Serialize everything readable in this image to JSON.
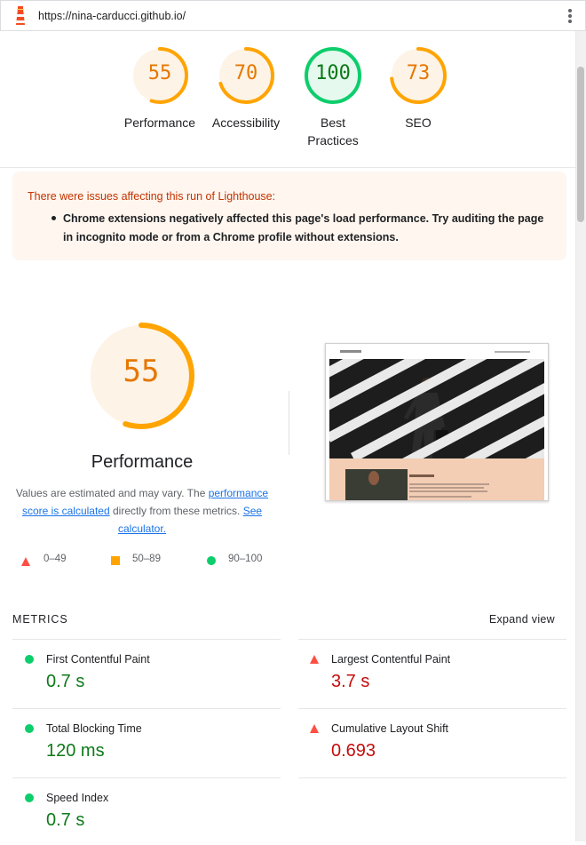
{
  "app": {
    "url": "https://nina-carducci.github.io/"
  },
  "colors": {
    "average": "#ffa400",
    "average_text": "#e67700",
    "pass": "#0cce6b",
    "pass_text": "#0c7a18",
    "fail": "#ff4e42",
    "fail_text": "#c50c0c",
    "link": "#1a73e8",
    "warning_bg": "#fef6ef",
    "warning_text": "#c33300"
  },
  "gauges": [
    {
      "score": "55",
      "label_line1": "Performance",
      "label_line2": "",
      "fraction": 0.55,
      "rating": "average"
    },
    {
      "score": "70",
      "label_line1": "Accessibility",
      "label_line2": "",
      "fraction": 0.7,
      "rating": "average"
    },
    {
      "score": "100",
      "label_line1": "Best",
      "label_line2": "Practices",
      "fraction": 1.0,
      "rating": "pass"
    },
    {
      "score": "73",
      "label_line1": "SEO",
      "label_line2": "",
      "fraction": 0.73,
      "rating": "average"
    }
  ],
  "warning": {
    "title": "There were issues affecting this run of Lighthouse:",
    "items": [
      "Chrome extensions negatively affected this page's load performance. Try auditing the page in incognito mode or from a Chrome profile without extensions."
    ]
  },
  "performance": {
    "score": "55",
    "fraction": 0.55,
    "title": "Performance",
    "desc_prefix": "Values are estimated and may vary. The ",
    "desc_link1": "performance score is calculated",
    "desc_middle": " directly from these metrics. ",
    "desc_link2": "See calculator."
  },
  "legend": {
    "fail": "0–49",
    "average": "50–89",
    "pass": "90–100"
  },
  "metrics": {
    "header": "METRICS",
    "expand": "Expand view",
    "items": [
      {
        "label": "First Contentful Paint",
        "value": "0.7 s",
        "rating": "pass"
      },
      {
        "label": "Largest Contentful Paint",
        "value": "3.7 s",
        "rating": "fail"
      },
      {
        "label": "Total Blocking Time",
        "value": "120 ms",
        "rating": "pass"
      },
      {
        "label": "Cumulative Layout Shift",
        "value": "0.693",
        "rating": "fail"
      },
      {
        "label": "Speed Index",
        "value": "0.7 s",
        "rating": "pass"
      }
    ]
  },
  "icons": {
    "logo": "lighthouse-logo-icon",
    "menu": "kebab-menu-icon"
  }
}
